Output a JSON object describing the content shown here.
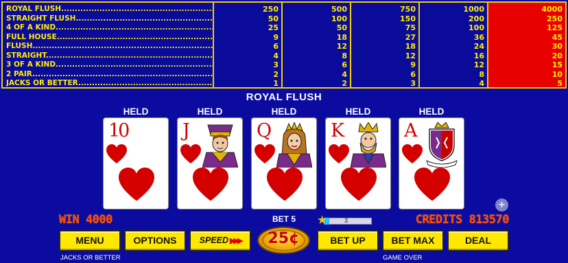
{
  "paytable": {
    "hands": [
      "ROYAL FLUSH",
      "STRAIGHT FLUSH",
      "4 OF A KIND",
      "FULL HOUSE",
      "FLUSH",
      "STRAIGHT",
      "3 OF A KIND",
      "2 PAIR",
      "JACKS OR BETTER"
    ],
    "columns": [
      [
        "250",
        "50",
        "25",
        "9",
        "6",
        "4",
        "3",
        "2",
        "1"
      ],
      [
        "500",
        "100",
        "50",
        "18",
        "12",
        "8",
        "6",
        "4",
        "2"
      ],
      [
        "750",
        "150",
        "75",
        "27",
        "18",
        "12",
        "9",
        "6",
        "3"
      ],
      [
        "1000",
        "200",
        "100",
        "36",
        "24",
        "16",
        "12",
        "8",
        "4"
      ],
      [
        "4000",
        "250",
        "125",
        "45",
        "30",
        "20",
        "15",
        "10",
        "5"
      ]
    ],
    "highlight_column": 4,
    "highlight_color": "#e80000",
    "text_color": "#ffef00",
    "border_color": "#f2d000"
  },
  "hand_result": "ROYAL FLUSH",
  "cards": [
    {
      "rank": "10",
      "suit": "hearts",
      "face": null,
      "held": "HELD"
    },
    {
      "rank": "J",
      "suit": "hearts",
      "face": "jack",
      "held": "HELD"
    },
    {
      "rank": "Q",
      "suit": "hearts",
      "face": "queen",
      "held": "HELD"
    },
    {
      "rank": "K",
      "suit": "hearts",
      "face": "king",
      "held": "HELD"
    },
    {
      "rank": "A",
      "suit": "hearts",
      "face": "crest",
      "held": "HELD"
    }
  ],
  "status": {
    "win": "WIN 4000",
    "bet": "BET 5",
    "credits": "CREDITS 813570",
    "speed_level": "3",
    "speed_fraction": 0.12
  },
  "buttons": {
    "menu": "MENU",
    "options": "OPTIONS",
    "speed": "SPEED",
    "denomination": "25¢",
    "bet_up": "BET UP",
    "bet_max": "BET MAX",
    "deal": "DEAL",
    "plus": "+"
  },
  "footer": {
    "game_name": "JACKS OR BETTER",
    "game_state": "GAME OVER"
  },
  "colors": {
    "background": "#0b0ba0",
    "button": "#ffe800",
    "accent_orange": "#ff4a00",
    "heart_red": "#d40000"
  }
}
